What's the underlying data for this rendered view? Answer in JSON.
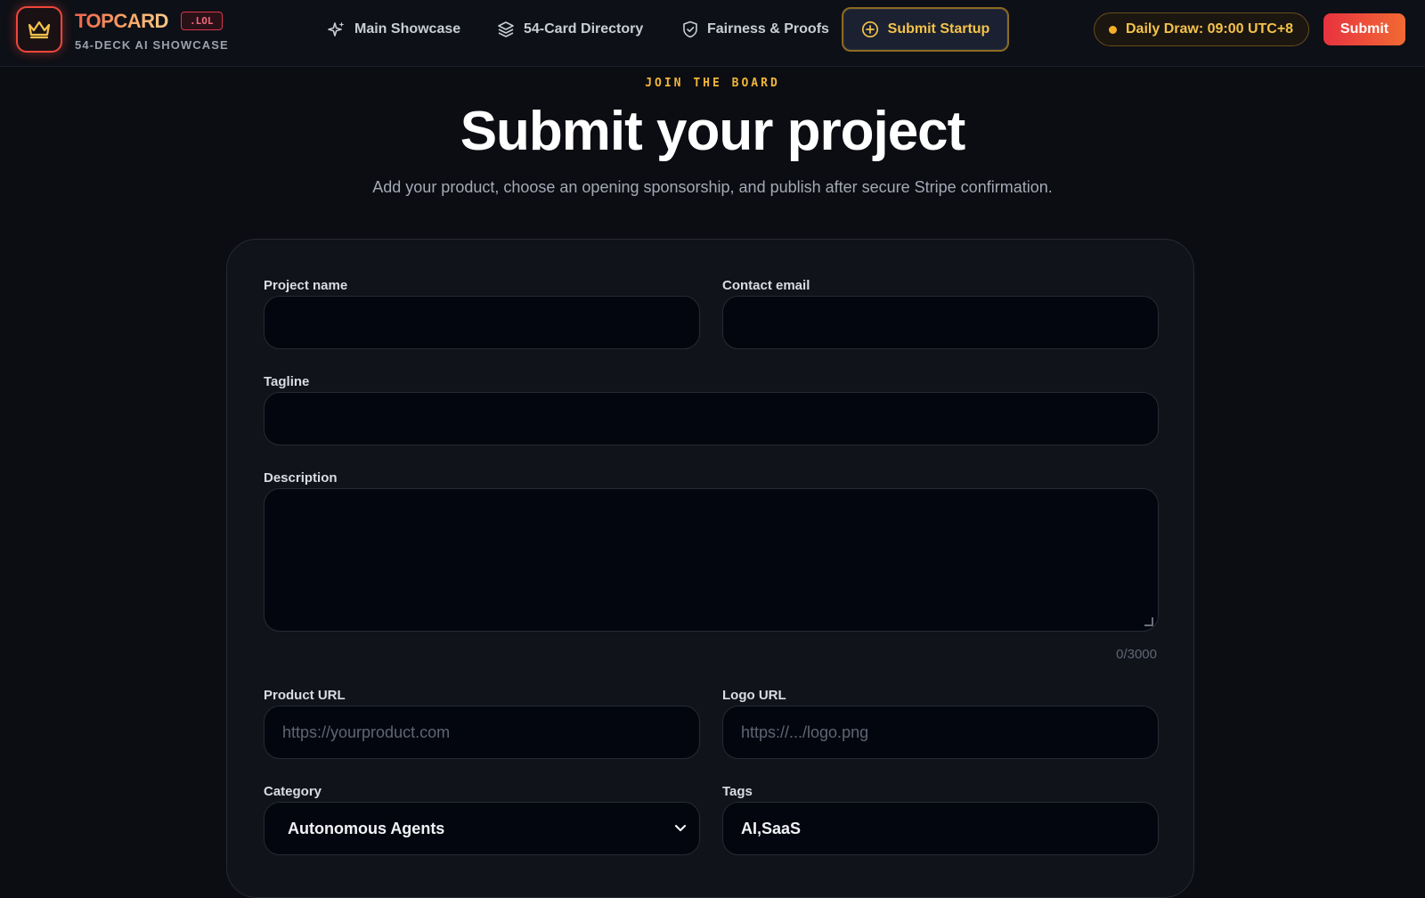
{
  "header": {
    "brand": "TOPCARD",
    "tld": ".LOL",
    "tagline": "54-DECK AI SHOWCASE",
    "nav": [
      {
        "label": "Main Showcase",
        "icon": "sparkles-icon"
      },
      {
        "label": "54-Card Directory",
        "icon": "layers-icon"
      },
      {
        "label": "Fairness & Proofs",
        "icon": "shield-check-icon"
      },
      {
        "label": "Submit Startup",
        "icon": "plus-circle-icon",
        "active": true
      }
    ],
    "daily_draw": "Daily Draw: 09:00 UTC+8",
    "submit_label": "Submit"
  },
  "hero": {
    "eyebrow": "JOIN THE BOARD",
    "title": "Submit your project",
    "subtitle": "Add your product, choose an opening sponsorship, and publish after secure Stripe confirmation."
  },
  "form": {
    "project_name": {
      "label": "Project name",
      "value": ""
    },
    "contact_email": {
      "label": "Contact email",
      "value": ""
    },
    "tagline": {
      "label": "Tagline",
      "value": ""
    },
    "description": {
      "label": "Description",
      "value": "",
      "counter": "0/3000"
    },
    "product_url": {
      "label": "Product URL",
      "placeholder": "https://yourproduct.com"
    },
    "logo_url": {
      "label": "Logo URL",
      "placeholder": "https://.../logo.png"
    },
    "category": {
      "label": "Category",
      "value": "Autonomous Agents"
    },
    "tags": {
      "label": "Tags",
      "value": "AI,SaaS"
    }
  },
  "colors": {
    "accent_gold": "#f4c24a",
    "accent_red": "#e8323f",
    "background": "#0b0d12",
    "card": "#10131a",
    "input": "#03060f"
  }
}
